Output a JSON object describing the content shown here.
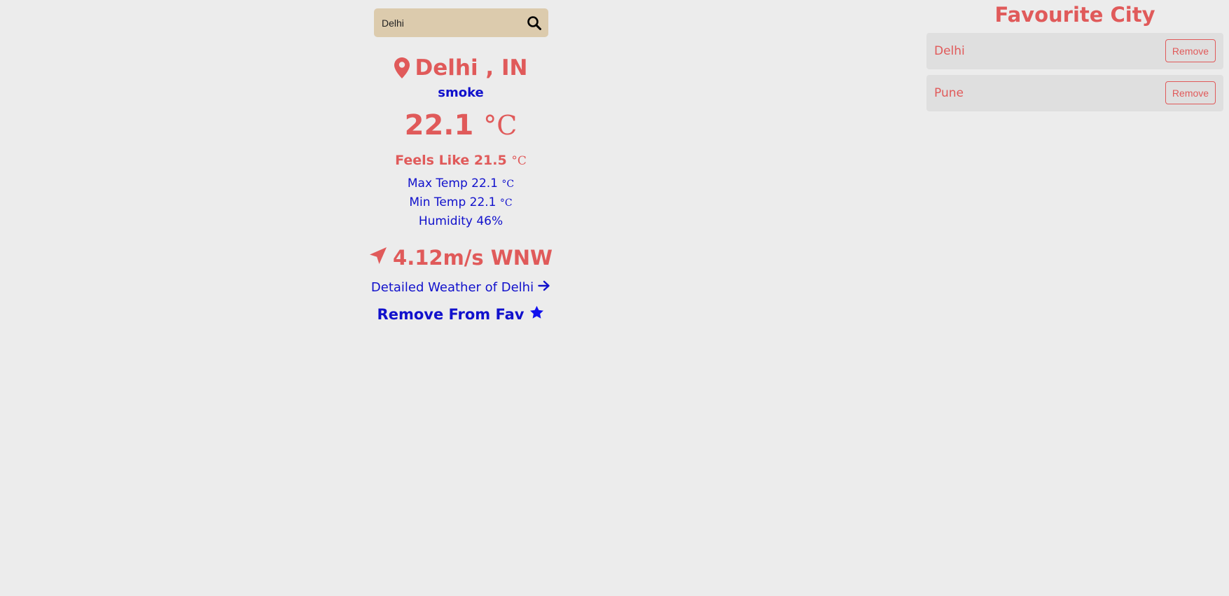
{
  "search": {
    "value": "Delhi",
    "icon": "search-icon"
  },
  "weather": {
    "location": "Delhi , IN",
    "location_icon": "map-marker-icon",
    "description": "smoke",
    "temperature": "22.1",
    "temp_unit": "°C",
    "feels_like_label": "Feels Like 21.5",
    "max_temp_label": "Max Temp 22.1",
    "min_temp_label": "Min Temp 22.1",
    "humidity_label": "Humidity 46%",
    "wind": "4.12m/s WNW",
    "wind_icon": "location-arrow-icon",
    "detail_link": "Detailed Weather of Delhi",
    "detail_icon": "arrow-right-icon",
    "fav_toggle": "Remove From Fav",
    "fav_icon": "star-icon"
  },
  "favourites": {
    "title": "Favourite City",
    "items": [
      {
        "name": "Delhi",
        "button": "Remove"
      },
      {
        "name": "Pune",
        "button": "Remove"
      }
    ]
  },
  "colors": {
    "background": "#ececec",
    "accent_red": "#e05a5a",
    "accent_blue": "#1111cc",
    "search_bg": "#dccbad",
    "card_bg": "#dfdfdf"
  }
}
